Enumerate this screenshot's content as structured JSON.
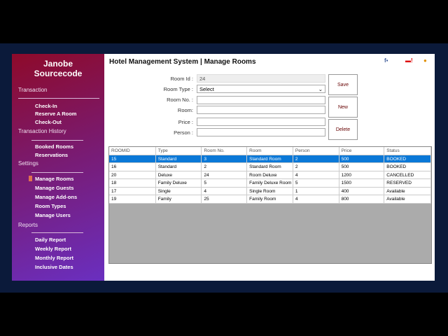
{
  "sidebar": {
    "brand_line1": "Janobe",
    "brand_line2": "Sourcecode",
    "sections": [
      {
        "title": "Transaction",
        "items": [
          "Check-In",
          "Reserve A Room",
          "Check-Out"
        ]
      },
      {
        "title": "Transaction History",
        "items": [
          "Booked Rooms",
          "Reservations"
        ]
      },
      {
        "title": "Settings",
        "items": [
          "Manage Rooms",
          "Manage Guests",
          "Manage Add-ons",
          "Room Types",
          "Manage Users"
        ]
      },
      {
        "title": "Reports",
        "items": [
          "Daily Report",
          "Weekly Report",
          "Monthly Report",
          "Inclusive Dates"
        ]
      }
    ],
    "active_item": "Manage Rooms"
  },
  "header": {
    "title": "Hotel Management System | Manage Rooms",
    "icons": [
      "facebook-icon",
      "youtube-icon",
      "user-icon"
    ]
  },
  "form": {
    "room_id_label": "Room Id :",
    "room_id_value": "24",
    "room_type_label": "Room Type :",
    "room_type_value": "Select",
    "room_no_label": "Room No. :",
    "room_label": "Room:",
    "price_label": "Price :",
    "person_label": "Person :"
  },
  "buttons": {
    "save": "Save",
    "new": "New",
    "delete": "Delete"
  },
  "grid": {
    "columns": [
      "ROOMID",
      "Type",
      "Room No.",
      "Room",
      "Person",
      "Price",
      "Status"
    ],
    "rows": [
      [
        "15",
        "Standard",
        "3",
        "Standard Room",
        "2",
        "500",
        "BOOKED"
      ],
      [
        "16",
        "Standard",
        "2",
        "Standard Room",
        "2",
        "500",
        "BOOKED"
      ],
      [
        "20",
        "Deluxe",
        "24",
        "Room Deluxe",
        "4",
        "1200",
        "CANCELLED"
      ],
      [
        "18",
        "Family Deluxe",
        "5",
        "Family Deluxe Room",
        "5",
        "1500",
        "RESERVED"
      ],
      [
        "17",
        "Single",
        "4",
        "Single Room",
        "1",
        "400",
        "Available"
      ],
      [
        "19",
        "Family",
        "25",
        "Family Room",
        "4",
        "800",
        "Available"
      ]
    ],
    "selected_row": 0,
    "selection_color": "#0a78d7"
  }
}
